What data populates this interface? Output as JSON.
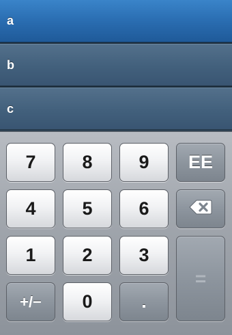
{
  "rows": [
    {
      "label": "a",
      "selected": true
    },
    {
      "label": "b",
      "selected": false
    },
    {
      "label": "c",
      "selected": false
    }
  ],
  "keypad": {
    "k7": "7",
    "k8": "8",
    "k9": "9",
    "ee": "EE",
    "k4": "4",
    "k5": "5",
    "k6": "6",
    "backspace_icon": "backspace-icon",
    "k1": "1",
    "k2": "2",
    "k3": "3",
    "equals": "=",
    "plusminus": "+/−",
    "k0": "0",
    "dot": "."
  },
  "colors": {
    "selected_row": "#2a6db1",
    "row": "#42607c",
    "keypad_bg": "#a2a7ae"
  }
}
